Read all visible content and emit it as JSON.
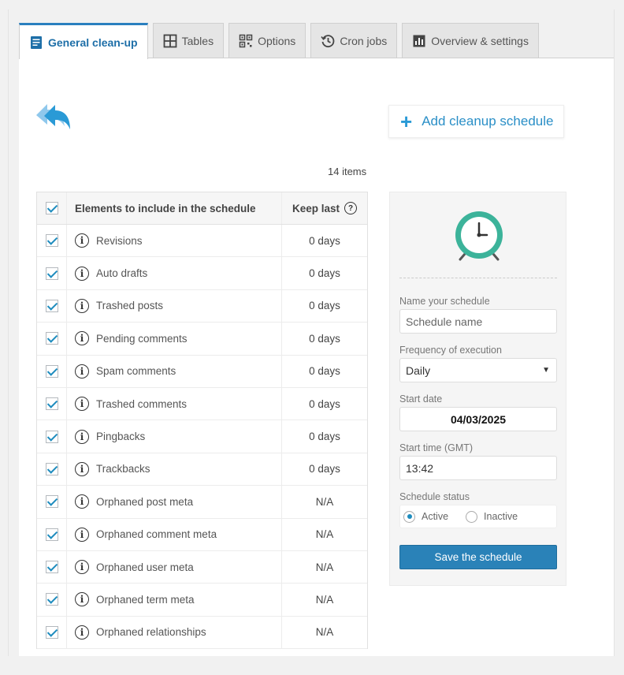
{
  "tabs": [
    {
      "label": "General clean-up",
      "icon": "document-list-icon",
      "active": true
    },
    {
      "label": "Tables",
      "icon": "table-grid-icon",
      "active": false
    },
    {
      "label": "Options",
      "icon": "qr-options-icon",
      "active": false
    },
    {
      "label": "Cron jobs",
      "icon": "history-clock-icon",
      "active": false
    },
    {
      "label": "Overview & settings",
      "icon": "overview-chart-icon",
      "active": false
    }
  ],
  "add_schedule_label": "Add cleanup schedule",
  "items_count": "14 items",
  "table": {
    "header_elements": "Elements to include in the schedule",
    "header_keep": "Keep last",
    "rows": [
      {
        "name": "Revisions",
        "keep": "0 days"
      },
      {
        "name": "Auto drafts",
        "keep": "0 days"
      },
      {
        "name": "Trashed posts",
        "keep": "0 days"
      },
      {
        "name": "Pending comments",
        "keep": "0 days"
      },
      {
        "name": "Spam comments",
        "keep": "0 days"
      },
      {
        "name": "Trashed comments",
        "keep": "0 days"
      },
      {
        "name": "Pingbacks",
        "keep": "0 days"
      },
      {
        "name": "Trackbacks",
        "keep": "0 days"
      },
      {
        "name": "Orphaned post meta",
        "keep": "N/A"
      },
      {
        "name": "Orphaned comment meta",
        "keep": "N/A"
      },
      {
        "name": "Orphaned user meta",
        "keep": "N/A"
      },
      {
        "name": "Orphaned term meta",
        "keep": "N/A"
      },
      {
        "name": "Orphaned relationships",
        "keep": "N/A"
      }
    ]
  },
  "schedule": {
    "name_label": "Name your schedule",
    "name_placeholder": "Schedule name",
    "frequency_label": "Frequency of execution",
    "frequency_value": "Daily",
    "start_date_label": "Start date",
    "start_date_value": "04/03/2025",
    "start_time_label": "Start time (GMT)",
    "start_time_value": "13:42",
    "status_label": "Schedule status",
    "status_active": "Active",
    "status_inactive": "Inactive",
    "save_label": "Save the schedule"
  },
  "colors": {
    "accent": "#2a82b8",
    "clock": "#3cb39a"
  }
}
